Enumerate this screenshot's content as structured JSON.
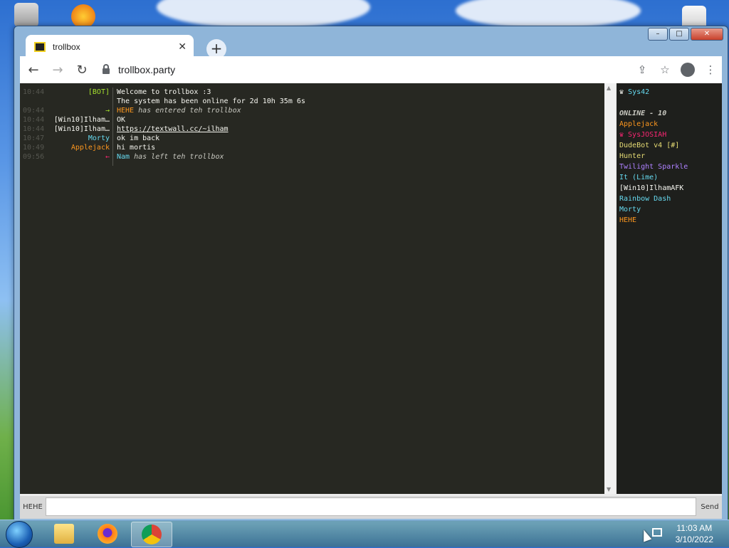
{
  "browser": {
    "tab": {
      "title": "trollbox",
      "close_glyph": "✕"
    },
    "newtab_glyph": "+",
    "address": "trollbox.party",
    "window_controls": {
      "minimize": "–",
      "maximize": "□",
      "close": "✕"
    }
  },
  "chat": {
    "messages": [
      {
        "time": "10:44",
        "nick": "[BOT]",
        "nick_color": "#a6e22e",
        "text": "Welcome to trollbox :3",
        "style": "normal"
      },
      {
        "time": "",
        "nick": "",
        "nick_color": "#a6e22e",
        "text": "The system has been online for 2d 10h 35m 6s",
        "style": "normal"
      },
      {
        "time": "09:44",
        "nick": "→",
        "nick_color": "#a6e22e",
        "actor": "HEHE",
        "actor_color": "#fd971f",
        "text": "has entered teh trollbox",
        "style": "join"
      },
      {
        "time": "10:44",
        "nick": "[Win10]Ilham…",
        "nick_color": "#f8f8f2",
        "text": "OK",
        "style": "normal"
      },
      {
        "time": "10:44",
        "nick": "[Win10]Ilham…",
        "nick_color": "#f8f8f2",
        "text": "https://textwall.cc/~ilham",
        "style": "link"
      },
      {
        "time": "10:47",
        "nick": "Morty",
        "nick_color": "#66d9ef",
        "text": "ok im back",
        "style": "normal"
      },
      {
        "time": "10:49",
        "nick": "Applejack",
        "nick_color": "#fd971f",
        "text": "hi mortis",
        "style": "normal"
      },
      {
        "time": "09:56",
        "nick": "←",
        "nick_color": "#f92672",
        "actor": "Nam",
        "actor_color": "#66d9ef",
        "text": "has left teh trollbox",
        "style": "leave"
      }
    ]
  },
  "users": {
    "self": {
      "icon": "♛",
      "name": "Sys42",
      "color": "#66d9ef"
    },
    "online_label": "ONLINE - 10",
    "list": [
      {
        "name": "Applejack",
        "color": "#fd971f"
      },
      {
        "name": "♛ SysJOSIAH",
        "color": "#f92672"
      },
      {
        "name": "DudeBot v4 [#]",
        "color": "#e6db74"
      },
      {
        "name": "Hunter",
        "color": "#e6db74"
      },
      {
        "name": "Twilight Sparkle",
        "color": "#ae81ff"
      },
      {
        "name": "It (Lime)",
        "color": "#66d9ef"
      },
      {
        "name": "[Win10]IlhamAFK",
        "color": "#f8f8f2"
      },
      {
        "name": "Rainbow Dash",
        "color": "#66d9ef"
      },
      {
        "name": "Morty",
        "color": "#66d9ef"
      },
      {
        "name": "HEHE",
        "color": "#fd971f"
      }
    ]
  },
  "input": {
    "nick": "HEHE",
    "message": "",
    "send_label": "Send"
  },
  "taskbar": {
    "time": "11:03 AM",
    "date": "3/10/2022"
  }
}
